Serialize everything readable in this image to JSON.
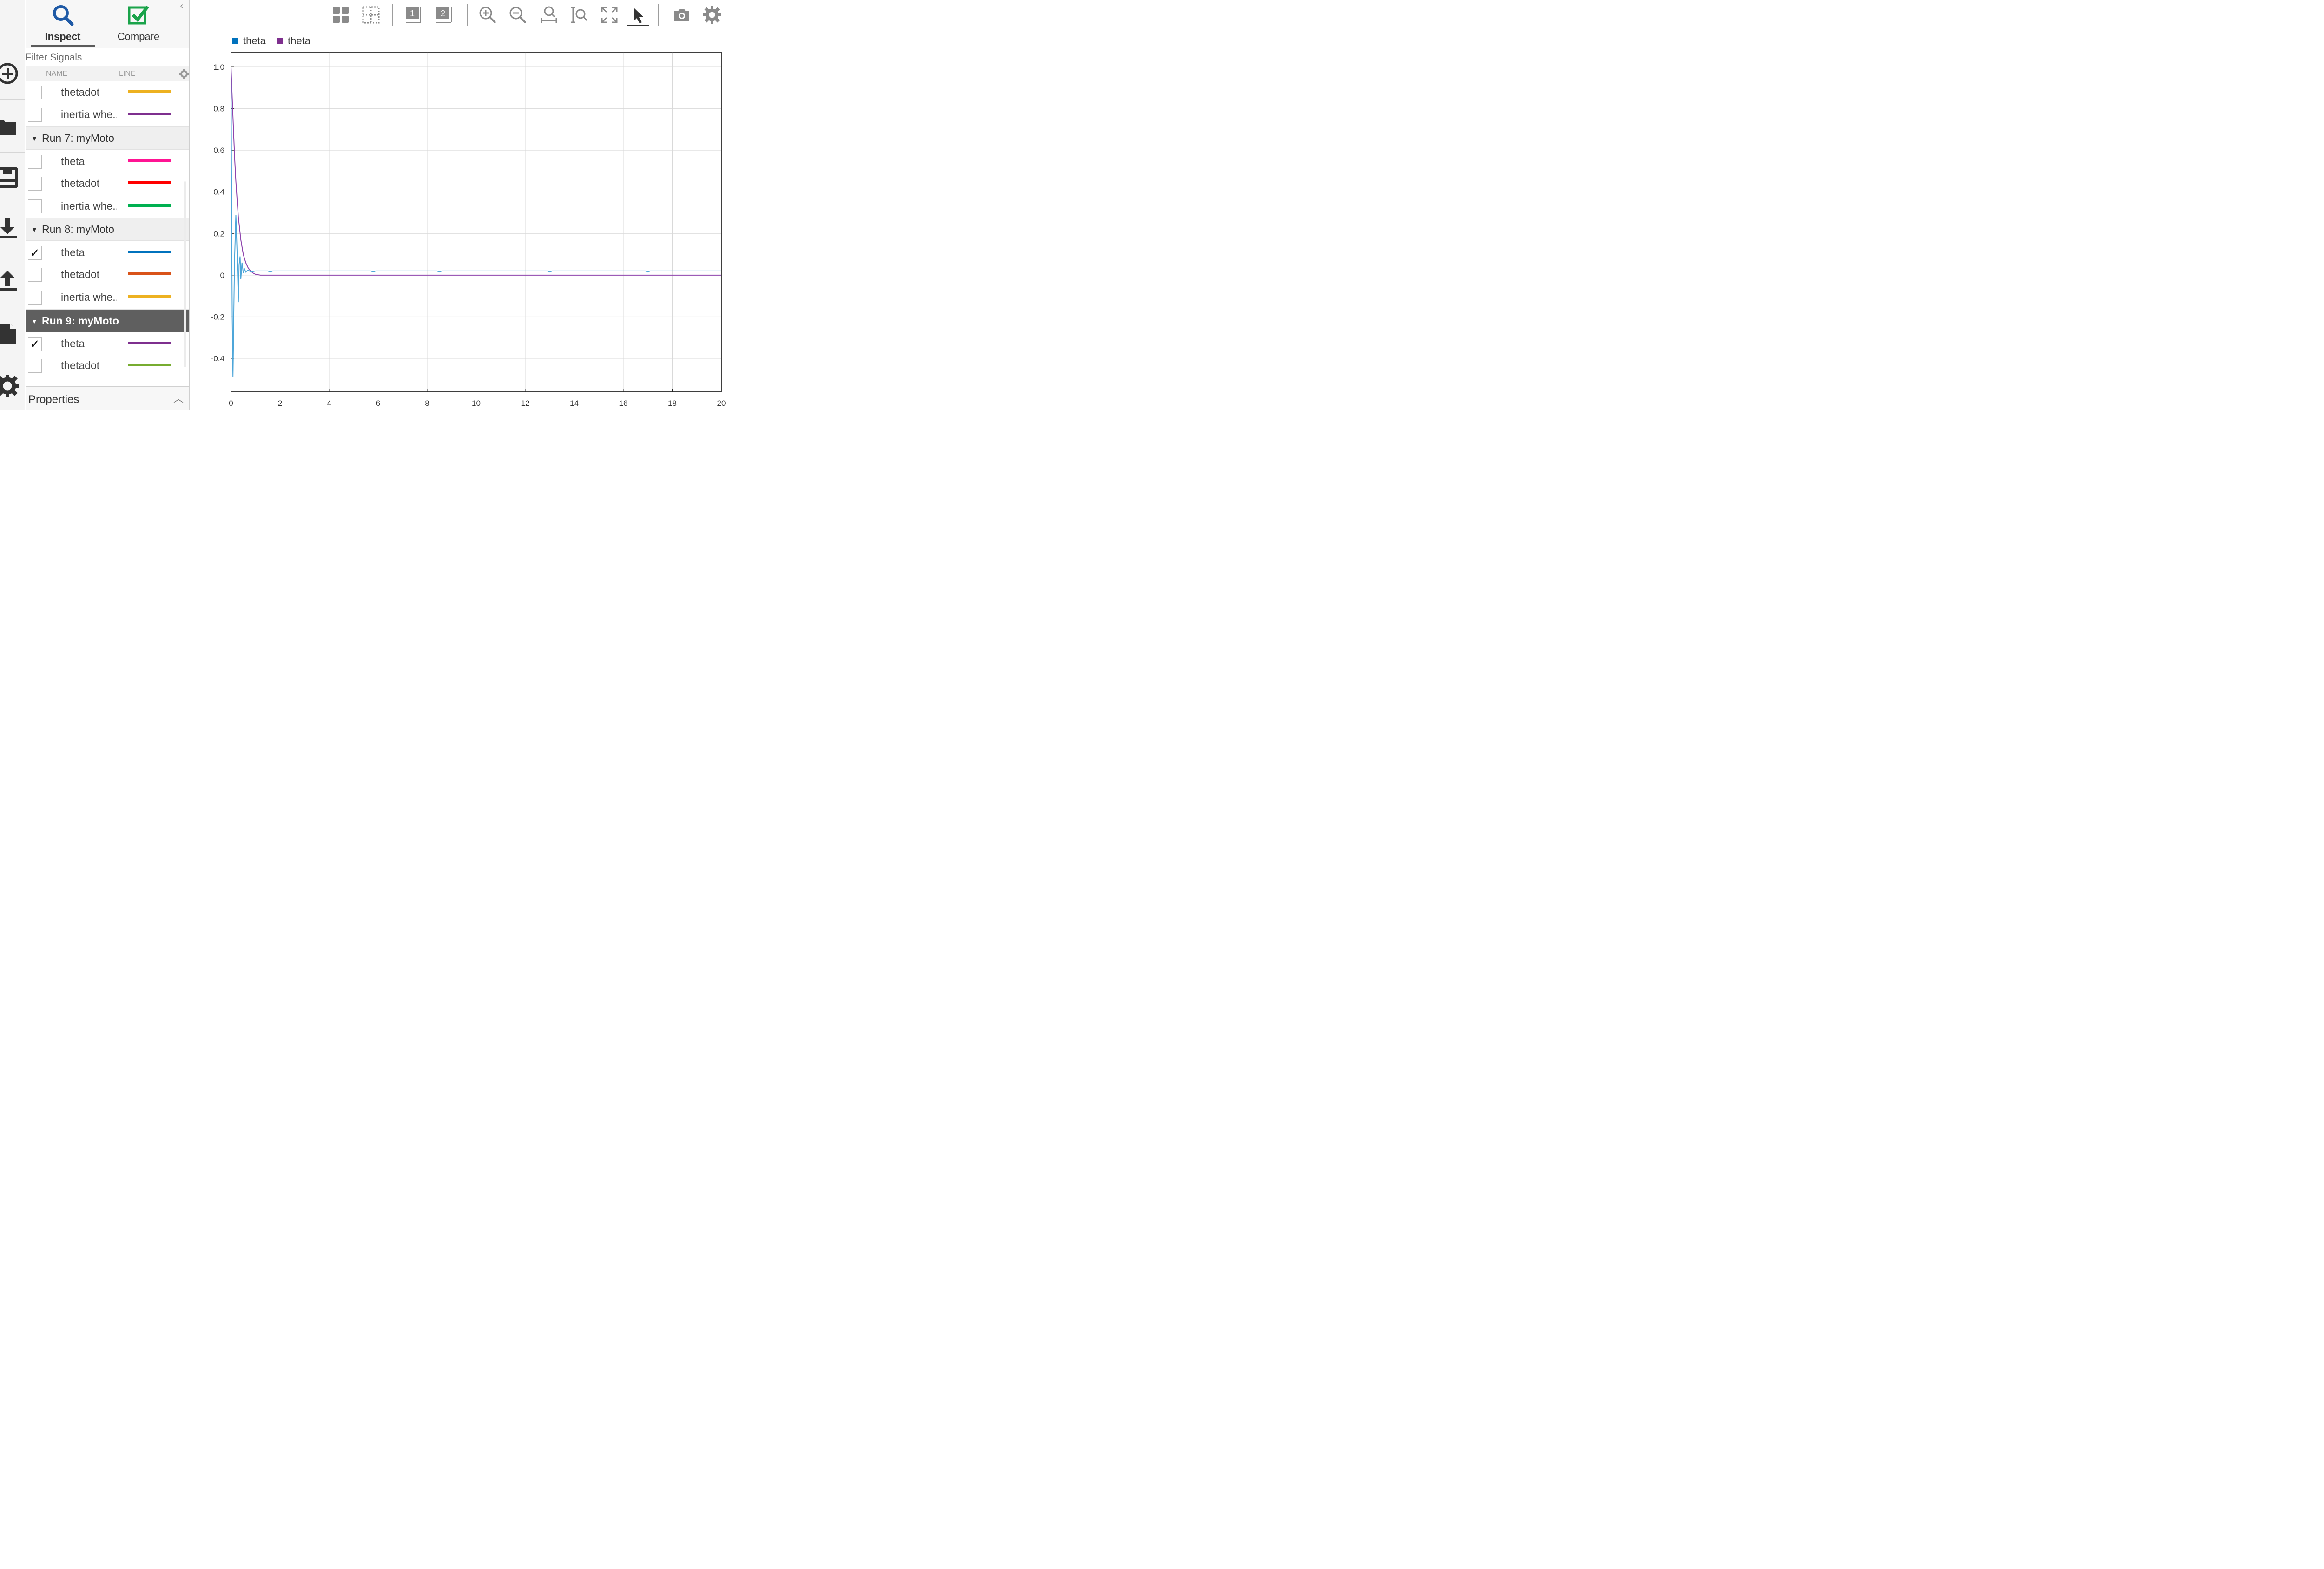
{
  "tabs": [
    {
      "label": "Inspect",
      "icon": "search-icon",
      "active": true
    },
    {
      "label": "Compare",
      "icon": "checkbox-icon",
      "active": false
    }
  ],
  "filter": {
    "placeholder": "Filter Signals"
  },
  "columns": {
    "name": "NAME",
    "line": "LINE"
  },
  "signals_top": [
    {
      "label": "thetadot",
      "color": "#EDB120",
      "checked": false
    },
    {
      "label": "inertia whe..",
      "color": "#7E2F8E",
      "checked": false
    }
  ],
  "runs": [
    {
      "title": "Run 7: myMoto",
      "selected": false,
      "signals": [
        {
          "label": "theta",
          "color": "#FF1493",
          "checked": false
        },
        {
          "label": "thetadot",
          "color": "#FF0000",
          "checked": false
        },
        {
          "label": "inertia whe..",
          "color": "#00B050",
          "checked": false
        }
      ]
    },
    {
      "title": "Run 8: myMoto",
      "selected": false,
      "signals": [
        {
          "label": "theta",
          "color": "#0072BD",
          "checked": true
        },
        {
          "label": "thetadot",
          "color": "#D95319",
          "checked": false
        },
        {
          "label": "inertia whe..",
          "color": "#EDB120",
          "checked": false
        }
      ]
    },
    {
      "title": "Run 9: myMoto",
      "selected": true,
      "signals": [
        {
          "label": "theta",
          "color": "#7E2F8E",
          "checked": true
        },
        {
          "label": "thetadot",
          "color": "#77AC30",
          "checked": false
        }
      ]
    }
  ],
  "properties": {
    "title": "Properties"
  },
  "toolbar": {
    "icons": [
      "layout-grid-icon",
      "subplot-grid-icon",
      "subplot-1-icon",
      "subplot-2-icon",
      "zoom-in-icon",
      "zoom-out-icon",
      "zoom-time-icon",
      "zoom-y-icon",
      "fit-to-view-icon",
      "cursor-icon",
      "snapshot-camera-icon",
      "settings-gear-icon"
    ]
  },
  "chart_data": {
    "type": "line",
    "title": "",
    "xlabel": "",
    "ylabel": "",
    "xlim": [
      0,
      20
    ],
    "ylim": [
      -0.5,
      1.05
    ],
    "xticks": [
      "0",
      "2",
      "4",
      "6",
      "8",
      "10",
      "12",
      "14",
      "16",
      "18",
      "20"
    ],
    "yticks": [
      "1.0",
      "0.8",
      "0.6",
      "0.4",
      "0.2",
      "0",
      "-0.2",
      "-0.4"
    ],
    "grid": true,
    "legend": "top-left",
    "series": [
      {
        "name": "theta",
        "color": "#4DA6D9",
        "legend_color": "#0072BD",
        "x": [
          0,
          0.02,
          0.05,
          0.08,
          0.1,
          0.14,
          0.2,
          0.25,
          0.3,
          0.33,
          0.37,
          0.4,
          0.45,
          0.5,
          0.55,
          0.6,
          0.7,
          0.8,
          1.0,
          1.5,
          1.6,
          1.7,
          5.7,
          5.8,
          5.9,
          8.4,
          8.5,
          8.6,
          12.9,
          13.0,
          13.1,
          16.9,
          17.0,
          17.1,
          20
        ],
        "y": [
          1.0,
          0.4,
          -0.2,
          -0.49,
          -0.3,
          0.05,
          0.29,
          0.1,
          -0.13,
          0.05,
          0.09,
          -0.02,
          0.06,
          0.01,
          0.03,
          0.015,
          0.025,
          0.015,
          0.02,
          0.02,
          0.015,
          0.02,
          0.02,
          0.015,
          0.02,
          0.02,
          0.015,
          0.02,
          0.02,
          0.015,
          0.02,
          0.02,
          0.015,
          0.02,
          0.02
        ]
      },
      {
        "name": "theta",
        "color": "#8E44AD",
        "legend_color": "#7E2F8E",
        "x": [
          0,
          0.05,
          0.1,
          0.15,
          0.2,
          0.25,
          0.3,
          0.4,
          0.5,
          0.6,
          0.7,
          0.8,
          0.9,
          1.0,
          1.2,
          1.5,
          20
        ],
        "y": [
          1.0,
          0.85,
          0.7,
          0.56,
          0.45,
          0.36,
          0.28,
          0.17,
          0.1,
          0.06,
          0.035,
          0.02,
          0.01,
          0.004,
          0.0,
          0.0,
          0.0
        ]
      }
    ]
  }
}
